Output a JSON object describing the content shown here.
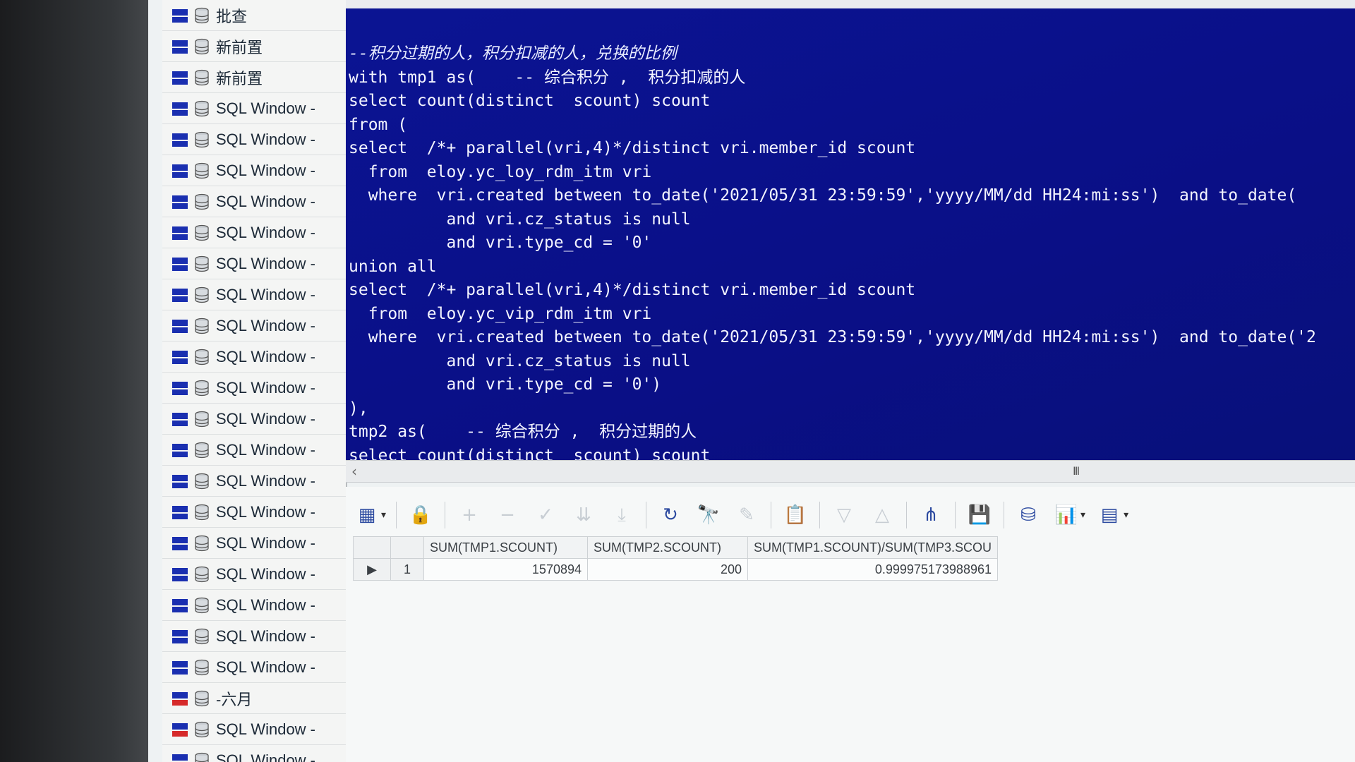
{
  "sidebar": {
    "items": [
      {
        "label": "批查",
        "flag": "blue"
      },
      {
        "label": "新前置",
        "flag": "blue"
      },
      {
        "label": "新前置",
        "flag": "blue"
      },
      {
        "label": "SQL Window -",
        "flag": "blue"
      },
      {
        "label": "SQL Window -",
        "flag": "blue"
      },
      {
        "label": "SQL Window -",
        "flag": "blue"
      },
      {
        "label": "SQL Window -",
        "flag": "blue"
      },
      {
        "label": "SQL Window -",
        "flag": "blue"
      },
      {
        "label": "SQL Window -",
        "flag": "blue"
      },
      {
        "label": "SQL Window -",
        "flag": "blue"
      },
      {
        "label": "SQL Window -",
        "flag": "blue"
      },
      {
        "label": "SQL Window -",
        "flag": "blue"
      },
      {
        "label": "SQL Window -",
        "flag": "blue"
      },
      {
        "label": "SQL Window -",
        "flag": "blue"
      },
      {
        "label": "SQL Window -",
        "flag": "blue"
      },
      {
        "label": "SQL Window -",
        "flag": "blue"
      },
      {
        "label": "SQL Window -",
        "flag": "blue"
      },
      {
        "label": "SQL Window -",
        "flag": "blue"
      },
      {
        "label": "SQL Window -",
        "flag": "blue"
      },
      {
        "label": "SQL Window -",
        "flag": "blue"
      },
      {
        "label": "SQL Window -",
        "flag": "blue"
      },
      {
        "label": "SQL Window -",
        "flag": "blue"
      },
      {
        "label": "-六月",
        "flag": "red"
      },
      {
        "label": "SQL Window -",
        "flag": "red"
      },
      {
        "label": "SQL Window -",
        "flag": "red"
      }
    ]
  },
  "editor": {
    "lines": [
      {
        "text": "--积分过期的人，积分扣减的人，兑换的比例",
        "comment": true
      },
      {
        "text": "with tmp1 as(    -- 综合积分 ,  积分扣减的人",
        "comment": false
      },
      {
        "text": "select count(distinct  scount) scount",
        "comment": false
      },
      {
        "text": "from (",
        "comment": false
      },
      {
        "text": "select  /*+ parallel(vri,4)*/distinct vri.member_id scount",
        "comment": false
      },
      {
        "text": "  from  eloy.yc_loy_rdm_itm vri",
        "comment": false
      },
      {
        "text": "  where  vri.created between to_date('2021/05/31 23:59:59','yyyy/MM/dd HH24:mi:ss')  and to_date(",
        "comment": false
      },
      {
        "text": "          and vri.cz_status is null",
        "comment": false
      },
      {
        "text": "          and vri.type_cd = '0'",
        "comment": false
      },
      {
        "text": "union all",
        "comment": false
      },
      {
        "text": "select  /*+ parallel(vri,4)*/distinct vri.member_id scount",
        "comment": false
      },
      {
        "text": "  from  eloy.yc_vip_rdm_itm vri",
        "comment": false
      },
      {
        "text": "  where  vri.created between to_date('2021/05/31 23:59:59','yyyy/MM/dd HH24:mi:ss')  and to_date('2",
        "comment": false
      },
      {
        "text": "          and vri.cz_status is null",
        "comment": false
      },
      {
        "text": "          and vri.type_cd = '0')",
        "comment": false
      },
      {
        "text": "),",
        "comment": false
      },
      {
        "text": "tmp2 as(    -- 综合积分 ,  积分过期的人",
        "comment": false
      },
      {
        "text": "select count(distinct  scount) scount",
        "comment": false
      }
    ],
    "scrollbar_grip": "III"
  },
  "toolbar": {
    "icons": [
      {
        "name": "grid-view-icon",
        "glyph": "▦",
        "enabled": true,
        "caret": true
      },
      {
        "name": "lock-icon",
        "glyph": "🔒",
        "enabled": true
      },
      {
        "name": "add-record-icon",
        "glyph": "+",
        "enabled": false
      },
      {
        "name": "delete-record-icon",
        "glyph": "−",
        "enabled": false
      },
      {
        "name": "post-changes-icon",
        "glyph": "✓",
        "enabled": false
      },
      {
        "name": "fetch-next-icon",
        "glyph": "⇊",
        "enabled": false
      },
      {
        "name": "fetch-last-icon",
        "glyph": "⤓",
        "enabled": false
      },
      {
        "name": "refresh-icon",
        "glyph": "↻",
        "enabled": true
      },
      {
        "name": "find-icon",
        "glyph": "🔭",
        "enabled": true
      },
      {
        "name": "clear-icon",
        "glyph": "✎",
        "enabled": false
      },
      {
        "name": "copy-icon",
        "glyph": "📋",
        "enabled": true
      },
      {
        "name": "next-icon",
        "glyph": "▽",
        "enabled": false
      },
      {
        "name": "previous-icon",
        "glyph": "△",
        "enabled": false
      },
      {
        "name": "tree-icon",
        "glyph": "⋔",
        "enabled": true
      },
      {
        "name": "save-icon",
        "glyph": "💾",
        "enabled": true
      },
      {
        "name": "export-db-icon",
        "glyph": "⛁",
        "enabled": true
      },
      {
        "name": "chart-icon",
        "glyph": "📊",
        "enabled": true,
        "caret": true
      },
      {
        "name": "report-icon",
        "glyph": "▤",
        "enabled": true,
        "caret": true
      }
    ]
  },
  "results": {
    "columns": [
      "SUM(TMP1.SCOUNT)",
      "SUM(TMP2.SCOUNT)",
      "SUM(TMP1.SCOUNT)/SUM(TMP3.SCOU"
    ],
    "rows": [
      {
        "num": "1",
        "cells": [
          "1570894",
          "200",
          "0.999975173988961"
        ]
      }
    ],
    "current_row_marker": "▶"
  },
  "colors": {
    "editor_bg": "#0a1090",
    "editor_text": "#f3f4ff",
    "flag_blue": "#1a2fb0",
    "flag_red": "#d62a2a"
  }
}
